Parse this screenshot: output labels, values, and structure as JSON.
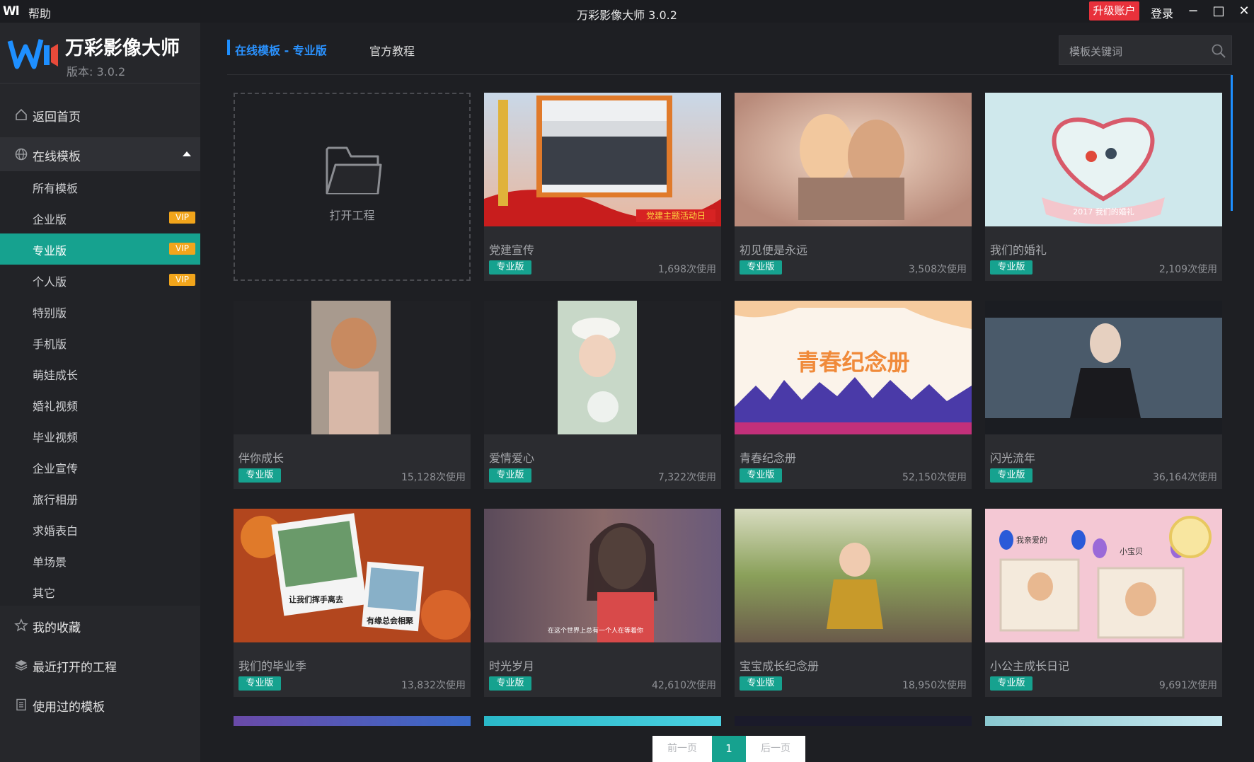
{
  "titlebar": {
    "logo": "Wl",
    "help": "帮助",
    "title": "万彩影像大师 3.0.2",
    "upgrade": "升级账户",
    "login": "登录",
    "minimize": "−",
    "maximize": "□",
    "close": "✕"
  },
  "brand": {
    "name": "万彩影像大师",
    "version": "版本: 3.0.2"
  },
  "sidebar": {
    "home": "返回首页",
    "online": "在线模板",
    "items": [
      {
        "label": "所有模板"
      },
      {
        "label": "企业版",
        "vip": "VIP"
      },
      {
        "label": "专业版",
        "vip": "VIP"
      },
      {
        "label": "个人版",
        "vip": "VIP"
      },
      {
        "label": "特别版"
      },
      {
        "label": "手机版"
      },
      {
        "label": "萌娃成长"
      },
      {
        "label": "婚礼视频"
      },
      {
        "label": "毕业视频"
      },
      {
        "label": "企业宣传"
      },
      {
        "label": "旅行相册"
      },
      {
        "label": "求婚表白"
      },
      {
        "label": "单场景"
      },
      {
        "label": "其它"
      }
    ],
    "favorites": "我的收藏",
    "recent": "最近打开的工程",
    "used": "使用过的模板"
  },
  "header": {
    "active_tab": "在线模板 - 专业版",
    "tutorial_tab": "官方教程",
    "search_placeholder": "模板关键词"
  },
  "open_project": "打开工程",
  "cards": [
    {
      "title": "党建宣传",
      "badge": "专业版",
      "count": "1,698次使用"
    },
    {
      "title": "初见便是永远",
      "badge": "专业版",
      "count": "3,508次使用"
    },
    {
      "title": "我们的婚礼",
      "badge": "专业版",
      "count": "2,109次使用"
    },
    {
      "title": "伴你成长",
      "badge": "专业版",
      "count": "15,128次使用"
    },
    {
      "title": "爱情爱心",
      "badge": "专业版",
      "count": "7,322次使用"
    },
    {
      "title": "青春纪念册",
      "badge": "专业版",
      "count": "52,150次使用"
    },
    {
      "title": "闪光流年",
      "badge": "专业版",
      "count": "36,164次使用"
    },
    {
      "title": "我们的毕业季",
      "badge": "专业版",
      "count": "13,832次使用"
    },
    {
      "title": "时光岁月",
      "badge": "专业版",
      "count": "42,610次使用"
    },
    {
      "title": "宝宝成长纪念册",
      "badge": "专业版",
      "count": "18,950次使用"
    },
    {
      "title": "小公主成长日记",
      "badge": "专业版",
      "count": "9,691次使用"
    }
  ],
  "thumb_text": {
    "party_banner": "党建主题活动日",
    "youth": "青春纪念册",
    "grad1": "让我们挥手离去",
    "grad2": "有缘总会相聚",
    "time_sub": "在这个世界上总有一个人在等着你",
    "princess1": "我亲爱的",
    "princess2": "小宝贝",
    "wedding_ribbon": "2017 我们的婚礼"
  },
  "pager": {
    "prev": "前一页",
    "current": "1",
    "next": "后一页"
  },
  "colors": {
    "accent_teal": "#16a28f",
    "accent_blue": "#2a92ff",
    "upgrade_red": "#e8313b",
    "vip_orange": "#f2a51b"
  }
}
